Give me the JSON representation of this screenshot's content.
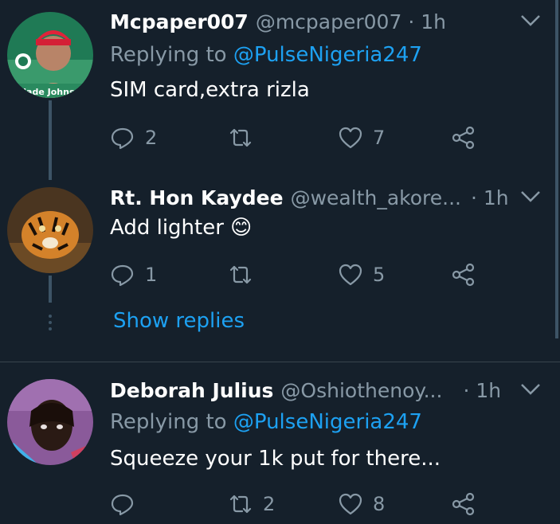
{
  "tweets": [
    {
      "name": "Mcpaper007",
      "handle": "@mcpaper007",
      "time": "· 1h",
      "reply_prefix": "Replying to",
      "reply_to": "@PulseNigeria247",
      "text": "SIM card,extra rizla",
      "replies": "2",
      "retweets": "",
      "likes": "7",
      "avatar_text": "Olade Johns..."
    },
    {
      "name": "Rt. Hon Kaydee",
      "handle": "@wealth_akore...",
      "time": "· 1h",
      "text": "Add lighter 😊",
      "replies": "1",
      "retweets": "",
      "likes": "5"
    },
    {
      "name": "Deborah Julius",
      "handle": "@Oshiothenoy...",
      "time": "· 1h",
      "reply_prefix": "Replying to",
      "reply_to": "@PulseNigeria247",
      "text": "Squeeze your 1k put for there...",
      "replies": "",
      "retweets": "2",
      "likes": "8"
    }
  ],
  "show_replies": "Show replies",
  "colors": {
    "background": "#15202b",
    "link": "#1da1f2",
    "muted": "#8899a6",
    "thread_line": "#3d5466"
  }
}
